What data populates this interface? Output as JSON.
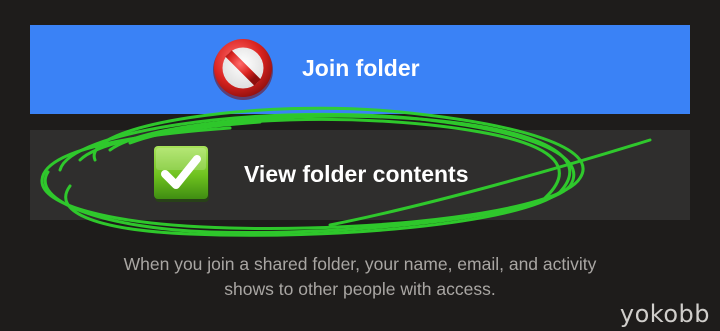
{
  "join_button": {
    "label": "Join folder",
    "icon": "prohibited-icon",
    "color": "#3a82f6"
  },
  "view_button": {
    "label": "View folder contents",
    "icon": "checkmark-icon",
    "color": "#2f2e2d"
  },
  "annotation": {
    "color": "#2fd12c"
  },
  "caption": {
    "line1": "When you join a shared folder, your name, email, and activity",
    "line2": "shows to other people with access."
  },
  "watermark": "yokobb"
}
